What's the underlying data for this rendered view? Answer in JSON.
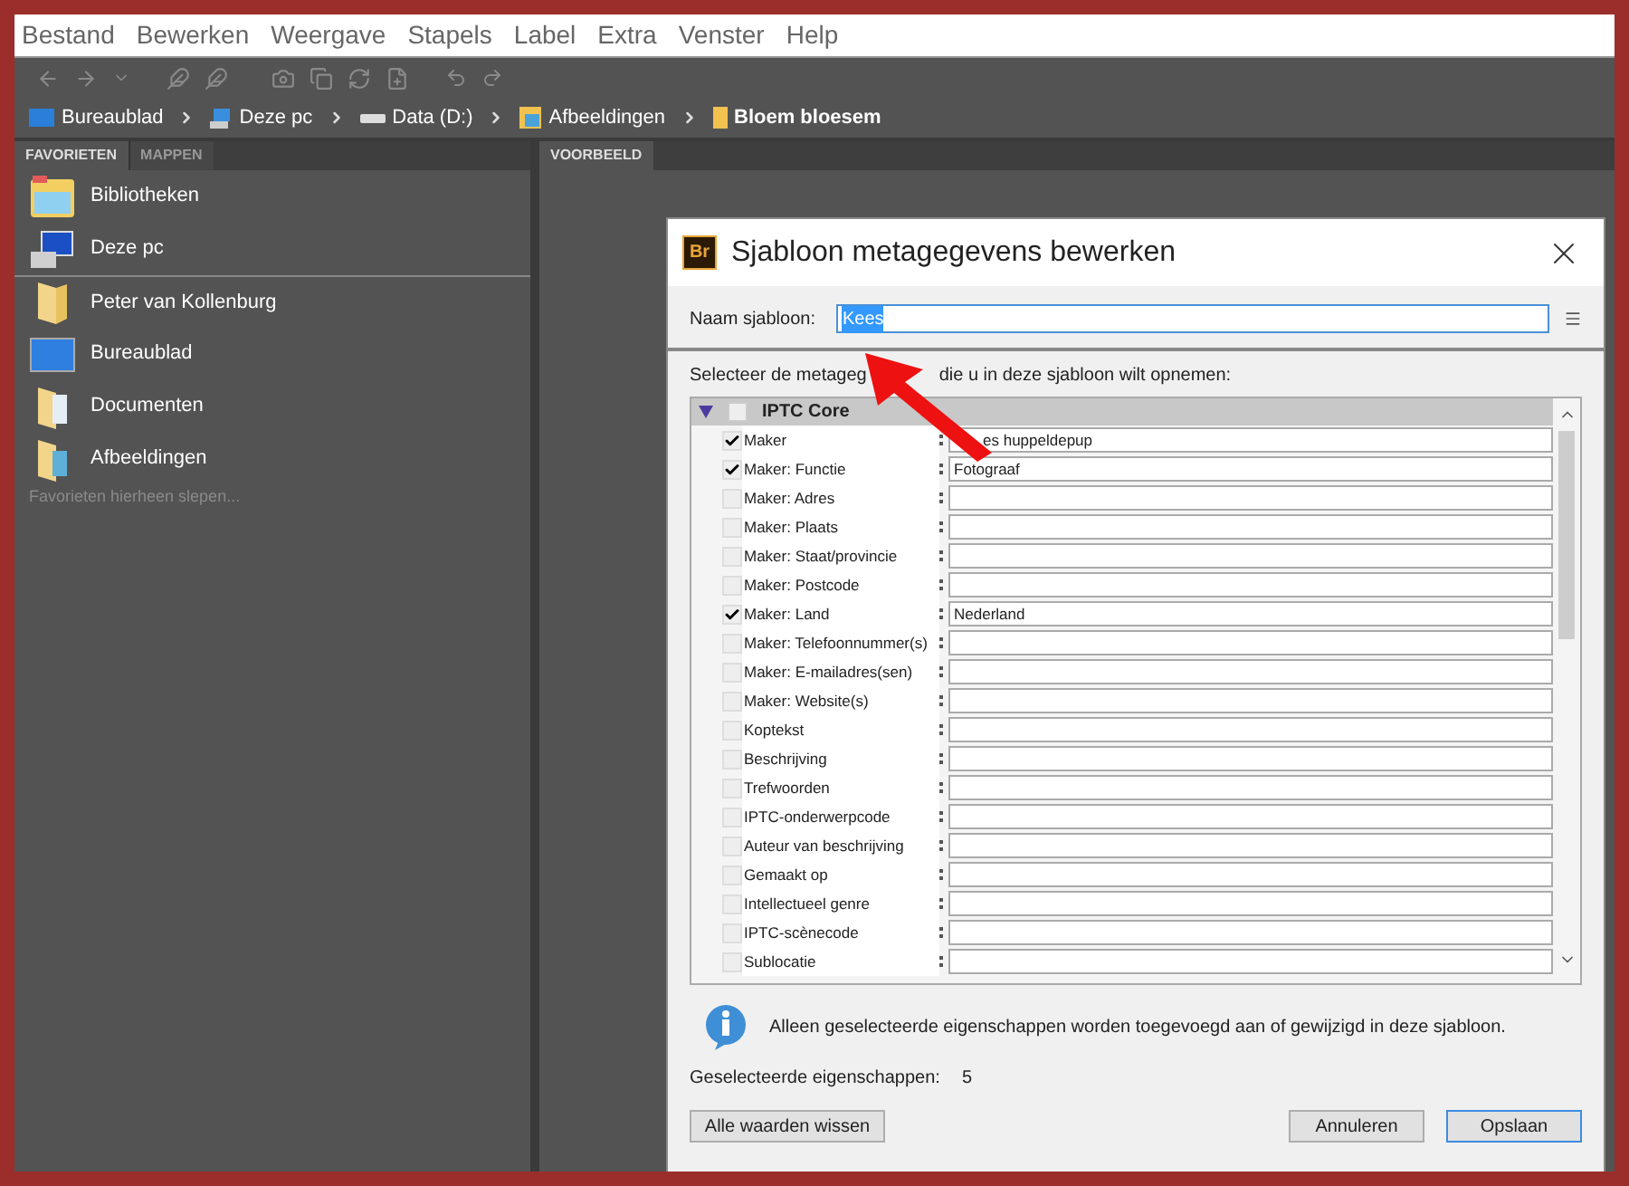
{
  "menu": [
    "Bestand",
    "Bewerken",
    "Weergave",
    "Stapels",
    "Label",
    "Extra",
    "Venster",
    "Help"
  ],
  "breadcrumb": [
    {
      "label": "Bureaublad",
      "kind": "desktop",
      "current": false
    },
    {
      "label": "Deze pc",
      "kind": "pc",
      "current": false
    },
    {
      "label": "Data (D:)",
      "kind": "drive",
      "current": false
    },
    {
      "label": "Afbeeldingen",
      "kind": "pictures",
      "current": false
    },
    {
      "label": "Bloem bloesem",
      "kind": "folder",
      "current": true
    }
  ],
  "left_tabs": [
    {
      "label": "FAVORIETEN",
      "selected": true
    },
    {
      "label": "MAPPEN",
      "selected": false
    }
  ],
  "favorites": [
    {
      "label": "Bibliotheken",
      "kind": "library"
    },
    {
      "label": "Deze pc",
      "kind": "pc"
    },
    {
      "label": "Peter van Kollenburg",
      "kind": "folder"
    },
    {
      "label": "Bureaublad",
      "kind": "desktop"
    },
    {
      "label": "Documenten",
      "kind": "documents"
    },
    {
      "label": "Afbeeldingen",
      "kind": "pictures"
    }
  ],
  "favorites_hint": "Favorieten hierheen slepen...",
  "right_tabs": [
    {
      "label": "VOORBEELD",
      "selected": true
    }
  ],
  "dialog": {
    "logo": "Br",
    "title": "Sjabloon metagegevens bewerken",
    "name_label": "Naam sjabloon:",
    "name_value": "Kees",
    "name_selected": true,
    "instruction": [
      "Selecteer de metageg",
      "die u in deze sjabloon wilt opnemen:"
    ],
    "group": {
      "label": "IPTC Core",
      "expanded": true,
      "checked": false
    },
    "rows": [
      {
        "label": "Maker",
        "checked": true,
        "value": "es huppeldepup"
      },
      {
        "label": "Maker: Functie",
        "checked": true,
        "value": "Fotograaf"
      },
      {
        "label": "Maker: Adres",
        "checked": false
      },
      {
        "label": "Maker: Plaats",
        "checked": false
      },
      {
        "label": "Maker: Staat/provincie",
        "checked": false
      },
      {
        "label": "Maker: Postcode",
        "checked": false
      },
      {
        "label": "Maker: Land",
        "checked": true,
        "value": "Nederland"
      },
      {
        "label": "Maker: Telefoonnummer(s)",
        "checked": false
      },
      {
        "label": "Maker: E-mailadres(sen)",
        "checked": false
      },
      {
        "label": "Maker: Website(s)",
        "checked": false
      },
      {
        "label": "Koptekst",
        "checked": false
      },
      {
        "label": "Beschrijving",
        "checked": false
      },
      {
        "label": "Trefwoorden",
        "checked": false
      },
      {
        "label": "IPTC-onderwerpcode",
        "checked": false
      },
      {
        "label": "Auteur van beschrijving",
        "checked": false
      },
      {
        "label": "Gemaakt op",
        "checked": false
      },
      {
        "label": "Intellectueel genre",
        "checked": false
      },
      {
        "label": "IPTC-scènecode",
        "checked": false
      },
      {
        "label": "Sublocatie",
        "checked": false
      }
    ],
    "info": "Alleen geselecteerde eigenschappen worden toegevoegd aan of gewijzigd in deze sjabloon.",
    "count_label": "Geselecteerde eigenschappen:",
    "count": "5",
    "buttons": [
      {
        "label": "Alle waarden wissen",
        "kind": "secondary"
      },
      {
        "label": "Annuleren",
        "kind": "secondary"
      },
      {
        "label": "Opslaan",
        "kind": "default"
      }
    ]
  }
}
